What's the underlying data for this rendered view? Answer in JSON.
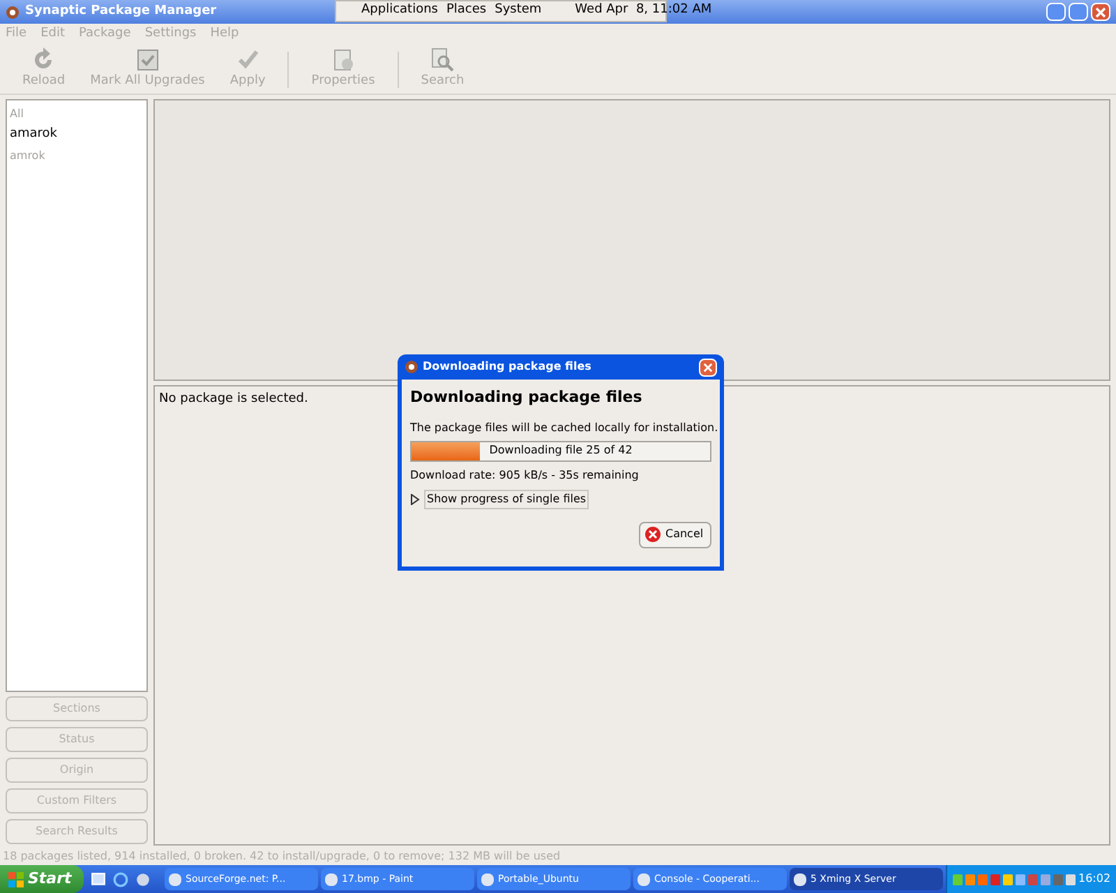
{
  "window": {
    "title": "Synaptic Package Manager"
  },
  "panel": {
    "menus": [
      "Applications",
      "Places",
      "System"
    ],
    "clock": "Wed Apr  8, 11:02 AM"
  },
  "menu": [
    "File",
    "Edit",
    "Package",
    "Settings",
    "Help"
  ],
  "toolbar": [
    {
      "label": "Reload",
      "disabled": true,
      "kind": "reload"
    },
    {
      "label": "Mark All Upgrades",
      "disabled": true,
      "kind": "upgrade"
    },
    {
      "label": "Apply",
      "disabled": true,
      "kind": "apply"
    },
    {
      "label": "Properties",
      "disabled": true,
      "kind": "properties"
    },
    {
      "label": "Search",
      "disabled": true,
      "kind": "search"
    }
  ],
  "sidebar": {
    "items": [
      {
        "label": "All",
        "disabled": true
      },
      {
        "label": "amarok",
        "disabled": false
      },
      {
        "label": "amrok",
        "disabled": true
      }
    ],
    "filters": [
      {
        "label": "Sections",
        "disabled": true
      },
      {
        "label": "Status",
        "disabled": true
      },
      {
        "label": "Origin",
        "disabled": true
      },
      {
        "label": "Custom Filters",
        "disabled": true
      },
      {
        "label": "Search Results",
        "disabled": true
      }
    ]
  },
  "details": {
    "text": "No package is selected."
  },
  "dialog": {
    "title": "Downloading package files",
    "heading": "Downloading package files",
    "message": "The package files will be cached locally for installation.",
    "progress": {
      "level": 0.23,
      "label": "Downloading file 25 of 42"
    },
    "rate": "Download rate: 905 kB/s - 35s remaining",
    "expander": {
      "label": "Show progress of single files",
      "expanded": false
    },
    "cancel": "Cancel"
  },
  "status_bar": "18 packages listed, 914 installed, 0 broken. 42 to install/upgrade, 0 to remove; 132 MB will be used",
  "taskbar": {
    "start": "Start",
    "tasks": [
      {
        "label": "SourceForge.net: P...",
        "selected": false
      },
      {
        "label": "17.bmp - Paint",
        "selected": false
      },
      {
        "label": "Portable_Ubuntu",
        "selected": false
      },
      {
        "label": "Console - Cooperati...",
        "selected": false
      },
      {
        "label": "5 Xming X Server",
        "selected": true
      }
    ],
    "clock": "16:02"
  }
}
